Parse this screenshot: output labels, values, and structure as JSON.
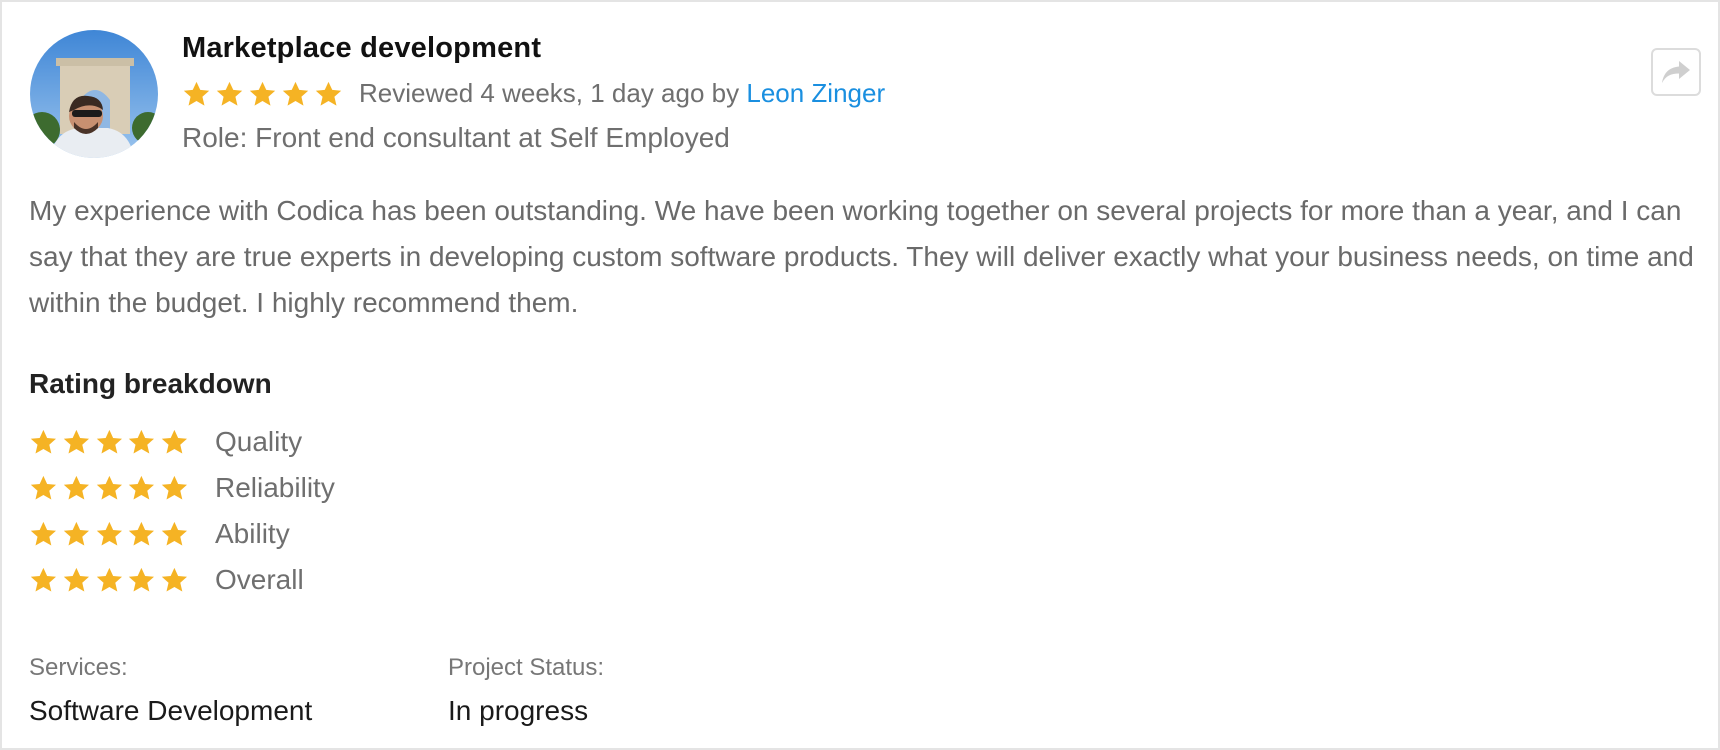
{
  "review": {
    "title": "Marketplace development",
    "rating": 5,
    "rating_max": 5,
    "reviewed_prefix": "Reviewed 4 weeks, 1 day ago by",
    "reviewer_name": "Leon Zinger",
    "role": "Role: Front end consultant at Self Employed",
    "body": "My experience with Codica has been outstanding. We have been working together on several projects for more than a year, and I can say that they are true experts in developing custom software products. They will deliver exactly what your business needs, on time and within the budget. I highly recommend them."
  },
  "breakdown": {
    "title": "Rating breakdown",
    "items": [
      {
        "label": "Quality",
        "rating": 5
      },
      {
        "label": "Reliability",
        "rating": 5
      },
      {
        "label": "Ability",
        "rating": 5
      },
      {
        "label": "Overall",
        "rating": 5
      }
    ]
  },
  "meta": {
    "services_label": "Services:",
    "services_value": "Software Development",
    "status_label": "Project Status:",
    "status_value": "In progress"
  },
  "icons": {
    "star": "star-icon",
    "share": "share-icon",
    "avatar": "avatar"
  },
  "colors": {
    "star": "#f5b324",
    "link": "#1a8fe0",
    "text_muted": "#6f6f6f",
    "border": "#e4e4e4"
  }
}
